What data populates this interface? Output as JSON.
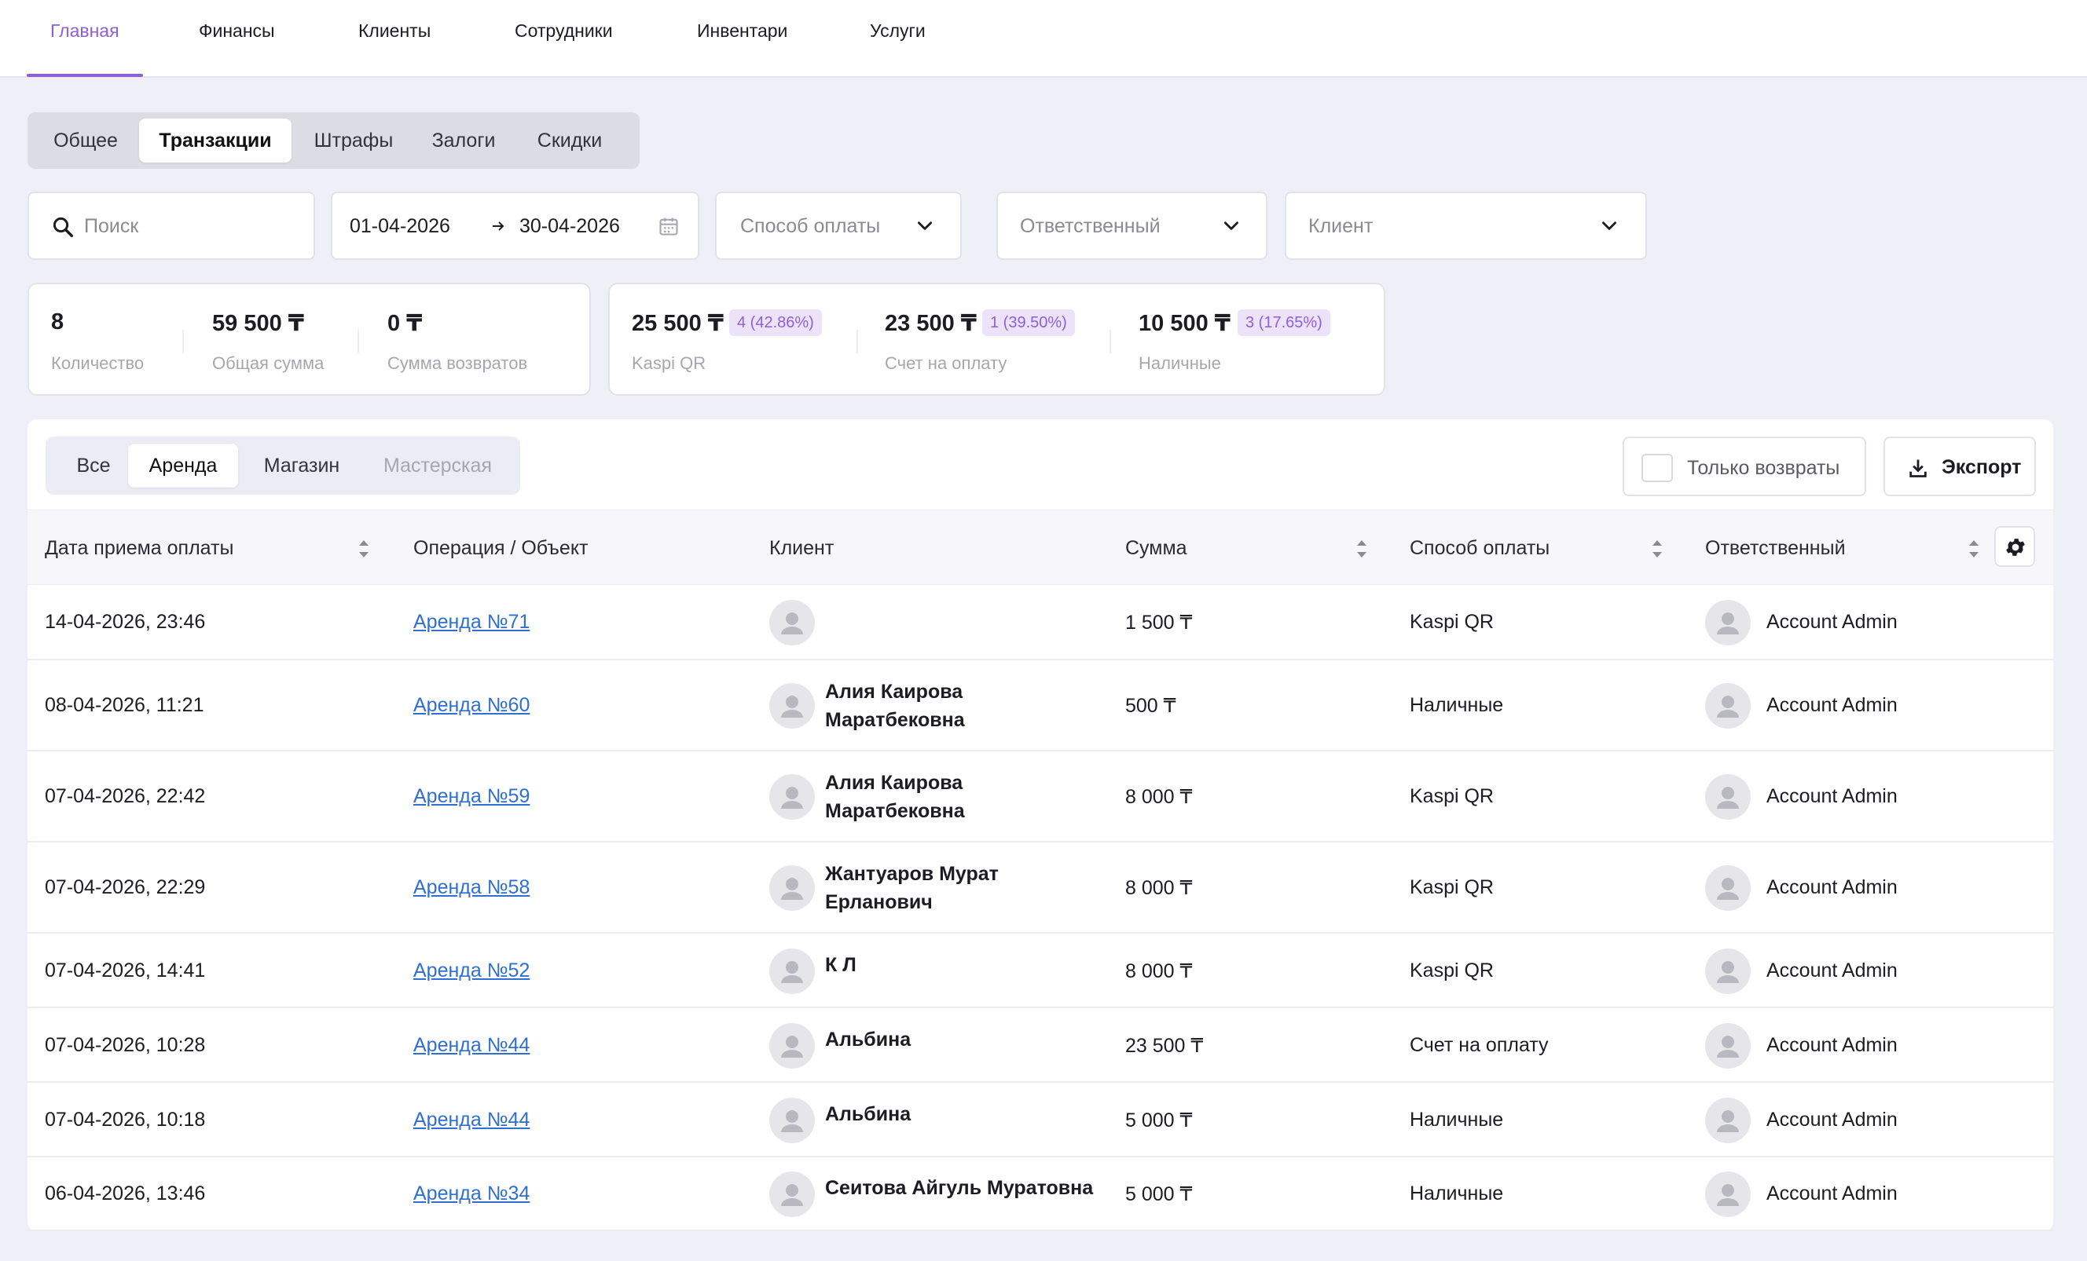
{
  "topnav": {
    "items": [
      {
        "label": "Главная",
        "active": true
      },
      {
        "label": "Финансы"
      },
      {
        "label": "Клиенты"
      },
      {
        "label": "Сотрудники"
      },
      {
        "label": "Инвентари"
      },
      {
        "label": "Услуги"
      }
    ]
  },
  "subtabs": [
    "Общее",
    "Транзакции",
    "Штрафы",
    "Залоги",
    "Скидки"
  ],
  "subtab_active": "Транзакции",
  "filters": {
    "search_placeholder": "Поиск",
    "date_from": "01-04-2026",
    "date_to": "30-04-2026",
    "payment_method_placeholder": "Способ оплаты",
    "responsible_placeholder": "Ответственный",
    "client_placeholder": "Клиент"
  },
  "stats": {
    "count_value": "8",
    "count_label": "Количество",
    "total_value": "59 500 ₸",
    "total_label": "Общая сумма",
    "refunds_value": "0 ₸",
    "refunds_label": "Сумма возвратов"
  },
  "methods": [
    {
      "value": "25 500 ₸",
      "badge": "4 (42.86%)",
      "label": "Kaspi QR"
    },
    {
      "value": "23 500 ₸",
      "badge": "1 (39.50%)",
      "label": "Счет на оплату"
    },
    {
      "value": "10 500 ₸",
      "badge": "3 (17.65%)",
      "label": "Наличные"
    }
  ],
  "category_tabs": [
    "Все",
    "Аренда",
    "Магазин",
    "Мастерская"
  ],
  "category_active": "Аренда",
  "refunds_only_label": "Только возвраты",
  "export_label": "Экспорт",
  "columns": {
    "date": "Дата приема оплаты",
    "operation": "Операция / Объект",
    "client": "Клиент",
    "amount": "Сумма",
    "method": "Способ оплаты",
    "responsible": "Ответственный"
  },
  "rows": [
    {
      "date": "14-04-2026, 23:46",
      "op": "Аренда №71",
      "client_line1": "",
      "client_line2": "",
      "amount": "1 500 ₸",
      "method": "Kaspi QR",
      "responsible": "Account Admin"
    },
    {
      "date": "08-04-2026, 11:21",
      "op": "Аренда №60",
      "client_line1": "Алия Каирова",
      "client_line2": "Маратбековна",
      "amount": "500 ₸",
      "method": "Наличные",
      "responsible": "Account Admin"
    },
    {
      "date": "07-04-2026, 22:42",
      "op": "Аренда №59",
      "client_line1": "Алия Каирова",
      "client_line2": "Маратбековна",
      "amount": "8 000 ₸",
      "method": "Kaspi QR",
      "responsible": "Account Admin"
    },
    {
      "date": "07-04-2026, 22:29",
      "op": "Аренда №58",
      "client_line1": "Жантуаров Мурат",
      "client_line2": "Ерланович",
      "amount": "8 000 ₸",
      "method": "Kaspi QR",
      "responsible": "Account Admin"
    },
    {
      "date": "07-04-2026, 14:41",
      "op": "Аренда №52",
      "client_line1": "К Л",
      "client_line2": "",
      "amount": "8 000 ₸",
      "method": "Kaspi QR",
      "responsible": "Account Admin"
    },
    {
      "date": "07-04-2026, 10:28",
      "op": "Аренда №44",
      "client_line1": "Альбина",
      "client_line2": "",
      "amount": "23 500 ₸",
      "method": "Счет на оплату",
      "responsible": "Account Admin"
    },
    {
      "date": "07-04-2026, 10:18",
      "op": "Аренда №44",
      "client_line1": "Альбина",
      "client_line2": "",
      "amount": "5 000 ₸",
      "method": "Наличные",
      "responsible": "Account Admin"
    },
    {
      "date": "06-04-2026, 13:46",
      "op": "Аренда №34",
      "client_line1": "Сеитова Айгуль Муратовна",
      "client_line2": "",
      "amount": "5 000 ₸",
      "method": "Наличные",
      "responsible": "Account Admin"
    }
  ],
  "colors": {
    "accent": "#8f5fd8",
    "link": "#2f6fd1",
    "badge_bg": "#ece3fb"
  },
  "icons": [
    "search-icon",
    "arrow-right-icon",
    "calendar-icon",
    "chevron-down-icon",
    "download-icon",
    "gear-icon",
    "sort-icon",
    "user-avatar-icon"
  ]
}
